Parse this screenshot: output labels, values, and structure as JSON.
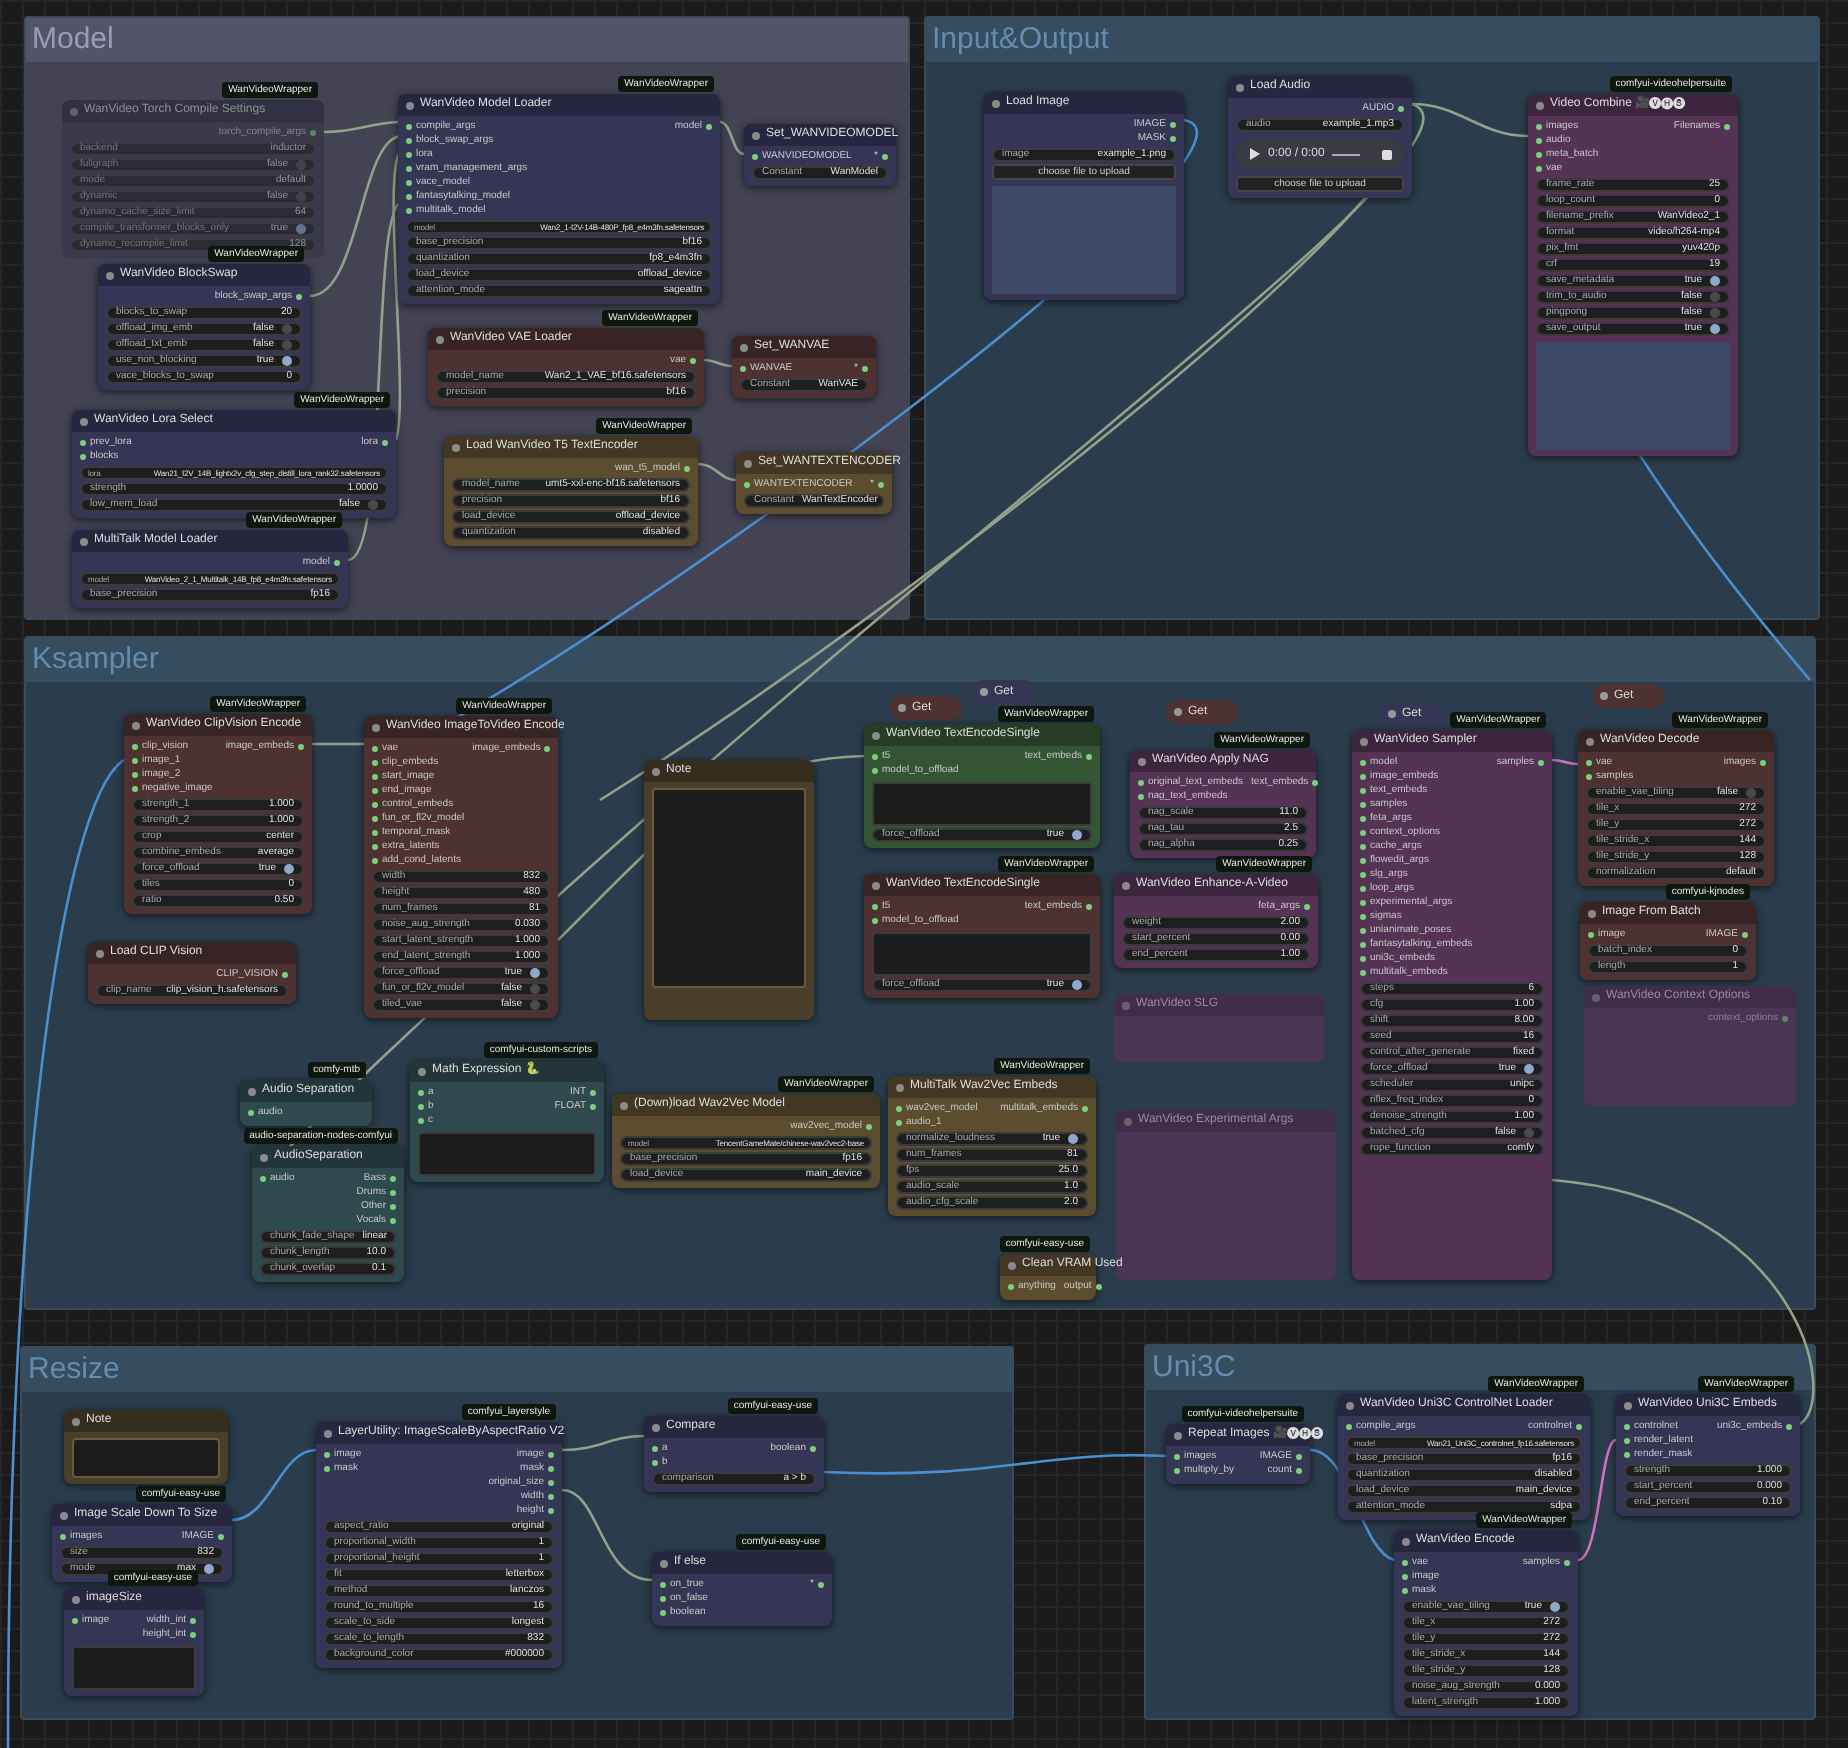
{
  "groups": [
    {
      "title": "Model",
      "color": "#434354"
    },
    {
      "title": "Input&Output",
      "color": "#2b3d4c"
    },
    {
      "title": "Ksampler",
      "color": "#2b3d4c"
    },
    {
      "title": "Resize",
      "color": "#2b3d4c"
    },
    {
      "title": "Uni3C",
      "color": "#2b3d4c"
    }
  ],
  "nodes": [
    {
      "kind": "node",
      "title": "WanVideo Torch Compile Settings",
      "badge": "WanVideoWrapper",
      "color": "#3a3a4c",
      "bypassed": true,
      "outputs": [
        "torch_compile_args"
      ],
      "widgets": [
        {
          "kind": "value",
          "label": "backend",
          "value": "inductor"
        },
        {
          "kind": "toggle",
          "label": "fullgraph",
          "value": "false",
          "on": false
        },
        {
          "kind": "value",
          "label": "mode",
          "value": "default"
        },
        {
          "kind": "toggle",
          "label": "dynamic",
          "value": "false",
          "on": false
        },
        {
          "kind": "value",
          "label": "dynamo_cache_size_limit",
          "value": "64"
        },
        {
          "kind": "toggle",
          "label": "compile_transformer_blocks_only",
          "value": "true",
          "on": true
        },
        {
          "kind": "value",
          "label": "dynamo_recompile_limit",
          "value": "128"
        }
      ]
    },
    {
      "kind": "node",
      "title": "WanVideo BlockSwap",
      "badge": "WanVideoWrapper",
      "color": "#353656",
      "outputs": [
        "block_swap_args"
      ],
      "widgets": [
        {
          "kind": "value",
          "label": "blocks_to_swap",
          "value": "20"
        },
        {
          "kind": "toggle",
          "label": "offload_img_emb",
          "value": "false",
          "on": false
        },
        {
          "kind": "toggle",
          "label": "offload_txt_emb",
          "value": "false",
          "on": false
        },
        {
          "kind": "toggle",
          "label": "use_non_blocking",
          "value": "true",
          "on": true
        },
        {
          "kind": "value",
          "label": "vace_blocks_to_swap",
          "value": "0"
        }
      ]
    },
    {
      "kind": "node",
      "title": "WanVideo Lora Select",
      "badge": "WanVideoWrapper",
      "color": "#353656",
      "inputs": [
        "prev_lora",
        "blocks"
      ],
      "outputs": [
        "lora"
      ],
      "widgets": [
        {
          "kind": "value",
          "label": "lora",
          "value": "Wan21_I2V_14B_lightx2v_cfg_step_distill_lora_rank32.safetensors"
        },
        {
          "kind": "value",
          "label": "strength",
          "value": "1.0000"
        },
        {
          "kind": "toggle",
          "label": "low_mem_load",
          "value": "false",
          "on": false
        }
      ]
    },
    {
      "kind": "node",
      "title": "MultiTalk Model Loader",
      "badge": "WanVideoWrapper",
      "color": "#353656",
      "outputs": [
        "model"
      ],
      "widgets": [
        {
          "kind": "value",
          "label": "model",
          "value": "WanVideo_2_1_Multitalk_14B_fp8_e4m3fn.safetensors"
        },
        {
          "kind": "value",
          "label": "base_precision",
          "value": "fp16"
        }
      ]
    },
    {
      "kind": "node",
      "title": "WanVideo Model Loader",
      "badge": "WanVideoWrapper",
      "color": "#353656",
      "inputs": [
        "compile_args",
        "block_swap_args",
        "lora",
        "vram_management_args",
        "vace_model",
        "fantasytalking_model",
        "multitalk_model"
      ],
      "outputs": [
        "model"
      ],
      "widgets": [
        {
          "kind": "value",
          "label": "model",
          "value": "Wan2_1-I2V-14B-480P_fp8_e4m3fn.safetensors"
        },
        {
          "kind": "value",
          "label": "base_precision",
          "value": "bf16"
        },
        {
          "kind": "value",
          "label": "quantization",
          "value": "fp8_e4m3fn"
        },
        {
          "kind": "value",
          "label": "load_device",
          "value": "offload_device"
        },
        {
          "kind": "value",
          "label": "attention_mode",
          "value": "sageattn"
        }
      ]
    },
    {
      "kind": "node",
      "title": "Set_WANVIDEOMODEL",
      "color": "#353656",
      "inputs": [
        "WANVIDEOMODEL"
      ],
      "outputs": [
        "*"
      ],
      "widgets": [
        {
          "kind": "value",
          "label": "Constant",
          "value": "WanModel"
        }
      ]
    },
    {
      "kind": "node",
      "title": "WanVideo VAE Loader",
      "badge": "WanVideoWrapper",
      "color": "#4e3232",
      "outputs": [
        "vae"
      ],
      "widgets": [
        {
          "kind": "value",
          "label": "model_name",
          "value": "Wan2_1_VAE_bf16.safetensors"
        },
        {
          "kind": "value",
          "label": "precision",
          "value": "bf16"
        }
      ]
    },
    {
      "kind": "node",
      "title": "Set_WANVAE",
      "color": "#4e3232",
      "inputs": [
        "WANVAE"
      ],
      "outputs": [
        "*"
      ],
      "widgets": [
        {
          "kind": "value",
          "label": "Constant",
          "value": "WanVAE"
        }
      ]
    },
    {
      "kind": "node",
      "title": "Load WanVideo T5 TextEncoder",
      "badge": "WanVideoWrapper",
      "color": "#5c4d2f",
      "outputs": [
        "wan_t5_model"
      ],
      "widgets": [
        {
          "kind": "value",
          "label": "model_name",
          "value": "umt5-xxl-enc-bf16.safetensors"
        },
        {
          "kind": "value",
          "label": "precision",
          "value": "bf16"
        },
        {
          "kind": "value",
          "label": "load_device",
          "value": "offload_device"
        },
        {
          "kind": "value",
          "label": "quantization",
          "value": "disabled"
        }
      ]
    },
    {
      "kind": "node",
      "title": "Set_WANTEXTENCODER",
      "color": "#5c4d2f",
      "inputs": [
        "WANTEXTENCODER"
      ],
      "outputs": [
        "*"
      ],
      "widgets": [
        {
          "kind": "value",
          "label": "Constant",
          "value": "WanTextEncoder"
        }
      ]
    },
    {
      "kind": "node",
      "title": "Load Image",
      "color": "#353656",
      "outputs": [
        "IMAGE",
        "MASK"
      ],
      "widgets": [
        {
          "kind": "value",
          "label": "image",
          "value": "example_1.png"
        },
        {
          "kind": "button",
          "label": "choose file to upload"
        }
      ],
      "photo": true
    },
    {
      "kind": "node",
      "title": "Load Audio",
      "color": "#353656",
      "outputs": [
        "AUDIO"
      ],
      "widgets": [
        {
          "kind": "value",
          "label": "audio",
          "value": "example_1.mp3"
        }
      ],
      "player_time": "0:00 / 0:00",
      "button": "choose file to upload"
    },
    {
      "kind": "node",
      "title": "Video Combine 🎥🅥🅗🅢",
      "badge": "comfyui-videohelpersuite",
      "color": "#553355",
      "inputs": [
        "images",
        "audio",
        "meta_batch",
        "vae"
      ],
      "outputs": [
        "Filenames"
      ],
      "widgets": [
        {
          "kind": "value",
          "label": "frame_rate",
          "value": "25"
        },
        {
          "kind": "value",
          "label": "loop_count",
          "value": "0"
        },
        {
          "kind": "value",
          "label": "filename_prefix",
          "value": "WanVideo2_1"
        },
        {
          "kind": "value",
          "label": "format",
          "value": "video/h264-mp4"
        },
        {
          "kind": "value",
          "label": "pix_fmt",
          "value": "yuv420p"
        },
        {
          "kind": "value",
          "label": "crf",
          "value": "19"
        },
        {
          "kind": "toggle",
          "label": "save_metadata",
          "value": "true",
          "on": true
        },
        {
          "kind": "toggle",
          "label": "trim_to_audio",
          "value": "false",
          "on": false
        },
        {
          "kind": "toggle",
          "label": "pingpong",
          "value": "false",
          "on": false
        },
        {
          "kind": "toggle",
          "label": "save_output",
          "value": "true",
          "on": true
        }
      ],
      "photo": true
    },
    {
      "kind": "node",
      "title": "WanVideo ClipVision Encode",
      "badge": "WanVideoWrapper",
      "color": "#4e3232",
      "inputs": [
        "clip_vision",
        "image_1",
        "image_2",
        "negative_image"
      ],
      "outputs": [
        "image_embeds"
      ],
      "widgets": [
        {
          "kind": "value",
          "label": "strength_1",
          "value": "1.000"
        },
        {
          "kind": "value",
          "label": "strength_2",
          "value": "1.000"
        },
        {
          "kind": "value",
          "label": "crop",
          "value": "center"
        },
        {
          "kind": "value",
          "label": "combine_embeds",
          "value": "average"
        },
        {
          "kind": "toggle",
          "label": "force_offload",
          "value": "true",
          "on": true
        },
        {
          "kind": "value",
          "label": "tiles",
          "value": "0"
        },
        {
          "kind": "value",
          "label": "ratio",
          "value": "0.50"
        }
      ]
    },
    {
      "kind": "node",
      "title": "Load CLIP Vision",
      "color": "#4e3232",
      "outputs": [
        "CLIP_VISION"
      ],
      "widgets": [
        {
          "kind": "value",
          "label": "clip_name",
          "value": "clip_vision_h.safetensors"
        }
      ]
    },
    {
      "kind": "node",
      "title": "WanVideo ImageToVideo Encode",
      "badge": "WanVideoWrapper",
      "color": "#4e3232",
      "inputs": [
        "vae",
        "clip_embeds",
        "start_image",
        "end_image",
        "control_embeds",
        "fun_or_fl2v_model",
        "temporal_mask",
        "extra_latents",
        "add_cond_latents"
      ],
      "outputs": [
        "image_embeds"
      ],
      "widgets": [
        {
          "kind": "value",
          "label": "width",
          "value": "832"
        },
        {
          "kind": "value",
          "label": "height",
          "value": "480"
        },
        {
          "kind": "value",
          "label": "num_frames",
          "value": "81"
        },
        {
          "kind": "value",
          "label": "noise_aug_strength",
          "value": "0.030"
        },
        {
          "kind": "value",
          "label": "start_latent_strength",
          "value": "1.000"
        },
        {
          "kind": "value",
          "label": "end_latent_strength",
          "value": "1.000"
        },
        {
          "kind": "toggle",
          "label": "force_offload",
          "value": "true",
          "on": true
        },
        {
          "kind": "toggle",
          "label": "fun_or_fl2v_model",
          "value": "false",
          "on": false
        },
        {
          "kind": "toggle",
          "label": "tiled_vae",
          "value": "false",
          "on": false
        }
      ]
    },
    {
      "kind": "note",
      "title": "Note",
      "color": "#4a3f2a"
    },
    {
      "kind": "get",
      "title": "Get",
      "color": "#4e3232"
    },
    {
      "kind": "get",
      "title": "Get",
      "color": "#353656"
    },
    {
      "kind": "get",
      "title": "Get",
      "color": "#4e3232"
    },
    {
      "kind": "get",
      "title": "Get",
      "color": "#353656"
    },
    {
      "kind": "get",
      "title": "Get",
      "color": "#4e3232"
    },
    {
      "kind": "node",
      "title": "WanVideo TextEncodeSingle",
      "badge": "WanVideoWrapper",
      "color": "#335533",
      "inputs": [
        "t5",
        "model_to_offload"
      ],
      "outputs": [
        "text_embeds"
      ],
      "text_area": true,
      "widgets": [
        {
          "kind": "toggle",
          "label": "force_offload",
          "value": "true",
          "on": true
        }
      ]
    },
    {
      "kind": "node",
      "title": "WanVideo TextEncodeSingle",
      "badge": "WanVideoWrapper",
      "color": "#4e3232",
      "inputs": [
        "t5",
        "model_to_offload"
      ],
      "outputs": [
        "text_embeds"
      ],
      "text_area": true,
      "widgets": [
        {
          "kind": "toggle",
          "label": "force_offload",
          "value": "true",
          "on": true
        }
      ]
    },
    {
      "kind": "node",
      "title": "WanVideo Apply NAG",
      "badge": "WanVideoWrapper",
      "color": "#553355",
      "inputs": [
        "original_text_embeds",
        "nag_text_embeds"
      ],
      "outputs": [
        "text_embeds"
      ],
      "widgets": [
        {
          "kind": "value",
          "label": "nag_scale",
          "value": "11.0"
        },
        {
          "kind": "value",
          "label": "nag_tau",
          "value": "2.5"
        },
        {
          "kind": "value",
          "label": "nag_alpha",
          "value": "0.25"
        }
      ]
    },
    {
      "kind": "node",
      "title": "WanVideo Enhance-A-Video",
      "badge": "WanVideoWrapper",
      "color": "#553355",
      "outputs": [
        "feta_args"
      ],
      "widgets": [
        {
          "kind": "value",
          "label": "weight",
          "value": "2.00"
        },
        {
          "kind": "value",
          "label": "start_percent",
          "value": "0.00"
        },
        {
          "kind": "value",
          "label": "end_percent",
          "value": "1.00"
        }
      ]
    },
    {
      "kind": "node",
      "title": "WanVideo SLG",
      "color": "#4b3556",
      "bypassed": true
    },
    {
      "kind": "node",
      "title": "WanVideo Experimental Args",
      "color": "#4b3556",
      "bypassed": true
    },
    {
      "kind": "node",
      "title": "WanVideo Sampler",
      "badge": "WanVideoWrapper",
      "color": "#553355",
      "inputs": [
        "model",
        "image_embeds",
        "text_embeds",
        "samples",
        "feta_args",
        "context_options",
        "cache_args",
        "flowedit_args",
        "slg_args",
        "loop_args",
        "experimental_args",
        "sigmas",
        "unianimate_poses",
        "fantasytalking_embeds",
        "uni3c_embeds",
        "multitalk_embeds"
      ],
      "outputs": [
        "samples"
      ],
      "widgets": [
        {
          "kind": "value",
          "label": "steps",
          "value": "6"
        },
        {
          "kind": "value",
          "label": "cfg",
          "value": "1.00"
        },
        {
          "kind": "value",
          "label": "shift",
          "value": "8.00"
        },
        {
          "kind": "value",
          "label": "seed",
          "value": "16"
        },
        {
          "kind": "value",
          "label": "control_after_generate",
          "value": "fixed"
        },
        {
          "kind": "toggle",
          "label": "force_offload",
          "value": "true",
          "on": true
        },
        {
          "kind": "value",
          "label": "scheduler",
          "value": "unipc"
        },
        {
          "kind": "value",
          "label": "riflex_freq_index",
          "value": "0"
        },
        {
          "kind": "value",
          "label": "denoise_strength",
          "value": "1.00"
        },
        {
          "kind": "toggle",
          "label": "batched_cfg",
          "value": "false",
          "on": false
        },
        {
          "kind": "value",
          "label": "rope_function",
          "value": "comfy"
        }
      ]
    },
    {
      "kind": "node",
      "title": "WanVideo Decode",
      "badge": "WanVideoWrapper",
      "color": "#4e3232",
      "inputs": [
        "vae",
        "samples"
      ],
      "outputs": [
        "images"
      ],
      "widgets": [
        {
          "kind": "toggle",
          "label": "enable_vae_tiling",
          "value": "false",
          "on": false
        },
        {
          "kind": "value",
          "label": "tile_x",
          "value": "272"
        },
        {
          "kind": "value",
          "label": "tile_y",
          "value": "272"
        },
        {
          "kind": "value",
          "label": "tile_stride_x",
          "value": "144"
        },
        {
          "kind": "value",
          "label": "tile_stride_y",
          "value": "128"
        },
        {
          "kind": "value",
          "label": "normalization",
          "value": "default"
        }
      ]
    },
    {
      "kind": "node",
      "title": "Image From Batch",
      "badge": "comfyui-kjnodes",
      "color": "#4e3232",
      "inputs": [
        "image"
      ],
      "outputs": [
        "IMAGE"
      ],
      "widgets": [
        {
          "kind": "value",
          "label": "batch_index",
          "value": "0"
        },
        {
          "kind": "value",
          "label": "length",
          "value": "1"
        }
      ]
    },
    {
      "kind": "node",
      "title": "WanVideo Context Options",
      "color": "#4b3556",
      "bypassed": true,
      "outputs": [
        "context_options"
      ]
    },
    {
      "kind": "node",
      "title": "Audio Separation",
      "badge": "comfy-mtb",
      "color": "#2f4a4e",
      "inputs": [
        "audio"
      ]
    },
    {
      "kind": "node",
      "title": "AudioSeparation",
      "badge": "audio-separation-nodes-comfyui",
      "color": "#2f4a4e",
      "inputs": [
        "audio"
      ],
      "outputs": [
        "Bass",
        "Drums",
        "Other",
        "Vocals"
      ],
      "widgets": [
        {
          "kind": "value",
          "label": "chunk_fade_shape",
          "value": "linear"
        },
        {
          "kind": "value",
          "label": "chunk_length",
          "value": "10.0"
        },
        {
          "kind": "value",
          "label": "chunk_overlap",
          "value": "0.1"
        }
      ]
    },
    {
      "kind": "node",
      "title": "Math Expression 🐍",
      "badge": "comfyui-custom-scripts",
      "color": "#2f4a4e",
      "inputs": [
        "a",
        "b",
        "c"
      ],
      "outputs": [
        "INT",
        "FLOAT"
      ],
      "text_area": true
    },
    {
      "kind": "node",
      "title": "(Down)load Wav2Vec Model",
      "badge": "WanVideoWrapper",
      "color": "#5c4d2f",
      "outputs": [
        "wav2vec_model"
      ],
      "widgets": [
        {
          "kind": "value",
          "label": "model",
          "value": "TencentGameMate/chinese-wav2vec2-base"
        },
        {
          "kind": "value",
          "label": "base_precision",
          "value": "fp16"
        },
        {
          "kind": "value",
          "label": "load_device",
          "value": "main_device"
        }
      ]
    },
    {
      "kind": "node",
      "title": "MultiTalk Wav2Vec Embeds",
      "badge": "WanVideoWrapper",
      "color": "#5c4d2f",
      "inputs": [
        "wav2vec_model",
        "audio_1"
      ],
      "outputs": [
        "multitalk_embeds"
      ],
      "widgets": [
        {
          "kind": "toggle",
          "label": "normalize_loudness",
          "value": "true",
          "on": true
        },
        {
          "kind": "value",
          "label": "num_frames",
          "value": "81"
        },
        {
          "kind": "value",
          "label": "fps",
          "value": "25.0"
        },
        {
          "kind": "value",
          "label": "audio_scale",
          "value": "1.0"
        },
        {
          "kind": "value",
          "label": "audio_cfg_scale",
          "value": "2.0"
        }
      ]
    },
    {
      "kind": "node",
      "title": "Clean VRAM Used",
      "badge": "comfyui-easy-use",
      "color": "#5c4d2f",
      "inputs": [
        "anything"
      ],
      "outputs": [
        "output"
      ]
    },
    {
      "kind": "note",
      "title": "Note",
      "color": "#4a3f2a"
    },
    {
      "kind": "node",
      "title": "Image Scale Down To Size",
      "badge": "comfyui-easy-use",
      "color": "#353656",
      "inputs": [
        "images"
      ],
      "outputs": [
        "IMAGE"
      ],
      "widgets": [
        {
          "kind": "value",
          "label": "size",
          "value": "832"
        },
        {
          "kind": "toggle",
          "label": "mode",
          "value": "max",
          "on": true
        }
      ]
    },
    {
      "kind": "node",
      "title": "imageSize",
      "badge": "comfyui-easy-use",
      "color": "#353656",
      "inputs": [
        "image"
      ],
      "outputs": [
        "width_int",
        "height_int"
      ],
      "text_area": true
    },
    {
      "kind": "node",
      "title": "LayerUtility: ImageScaleByAspectRatio V2",
      "badge": "comfyui_layerstyle",
      "color": "#353656",
      "inputs": [
        "image",
        "mask"
      ],
      "outputs": [
        "image",
        "mask",
        "original_size",
        "width",
        "height"
      ],
      "widgets": [
        {
          "kind": "value",
          "label": "aspect_ratio",
          "value": "original"
        },
        {
          "kind": "value",
          "label": "proportional_width",
          "value": "1"
        },
        {
          "kind": "value",
          "label": "proportional_height",
          "value": "1"
        },
        {
          "kind": "value",
          "label": "fit",
          "value": "letterbox"
        },
        {
          "kind": "value",
          "label": "method",
          "value": "lanczos"
        },
        {
          "kind": "value",
          "label": "round_to_multiple",
          "value": "16"
        },
        {
          "kind": "value",
          "label": "scale_to_side",
          "value": "longest"
        },
        {
          "kind": "value",
          "label": "scale_to_length",
          "value": "832"
        },
        {
          "kind": "value",
          "label": "background_color",
          "value": "#000000"
        }
      ]
    },
    {
      "kind": "node",
      "title": "Compare",
      "badge": "comfyui-easy-use",
      "color": "#353656",
      "inputs": [
        "a",
        "b"
      ],
      "outputs": [
        "boolean"
      ],
      "widgets": [
        {
          "kind": "value",
          "label": "comparison",
          "value": "a > b"
        }
      ]
    },
    {
      "kind": "node",
      "title": "If else",
      "badge": "comfyui-easy-use",
      "color": "#353656",
      "inputs": [
        "on_true",
        "on_false",
        "boolean"
      ],
      "outputs": [
        "*"
      ]
    },
    {
      "kind": "node",
      "title": "Repeat Images 🎥🅥🅗🅢",
      "badge": "comfyui-videohelpersuite",
      "color": "#353656",
      "inputs": [
        "images",
        "multiply_by"
      ],
      "outputs": [
        "IMAGE",
        "count"
      ]
    },
    {
      "kind": "node",
      "title": "WanVideo Uni3C ControlNet Loader",
      "badge": "WanVideoWrapper",
      "color": "#353656",
      "inputs": [
        "compile_args"
      ],
      "outputs": [
        "controlnet"
      ],
      "widgets": [
        {
          "kind": "value",
          "label": "model",
          "value": "Wan21_Uni3C_controlnet_fp16.safetensors"
        },
        {
          "kind": "value",
          "label": "base_precision",
          "value": "fp16"
        },
        {
          "kind": "value",
          "label": "quantization",
          "value": "disabled"
        },
        {
          "kind": "value",
          "label": "load_device",
          "value": "main_device"
        },
        {
          "kind": "value",
          "label": "attention_mode",
          "value": "sdpa"
        }
      ]
    },
    {
      "kind": "node",
      "title": "WanVideo Encode",
      "badge": "WanVideoWrapper",
      "color": "#353656",
      "inputs": [
        "vae",
        "image",
        "mask"
      ],
      "outputs": [
        "samples"
      ],
      "widgets": [
        {
          "kind": "toggle",
          "label": "enable_vae_tiling",
          "value": "true",
          "on": true
        },
        {
          "kind": "value",
          "label": "tile_x",
          "value": "272"
        },
        {
          "kind": "value",
          "label": "tile_y",
          "value": "272"
        },
        {
          "kind": "value",
          "label": "tile_stride_x",
          "value": "144"
        },
        {
          "kind": "value",
          "label": "tile_stride_y",
          "value": "128"
        },
        {
          "kind": "value",
          "label": "noise_aug_strength",
          "value": "0.000"
        },
        {
          "kind": "value",
          "label": "latent_strength",
          "value": "1.000"
        }
      ]
    },
    {
      "kind": "node",
      "title": "WanVideo Uni3C Embeds",
      "badge": "WanVideoWrapper",
      "color": "#353656",
      "inputs": [
        "controlnet",
        "render_latent",
        "render_mask"
      ],
      "outputs": [
        "uni3c_embeds"
      ],
      "widgets": [
        {
          "kind": "value",
          "label": "strength",
          "value": "1.000"
        },
        {
          "kind": "value",
          "label": "start_percent",
          "value": "0.000"
        },
        {
          "kind": "value",
          "label": "end_percent",
          "value": "0.10"
        }
      ]
    }
  ]
}
